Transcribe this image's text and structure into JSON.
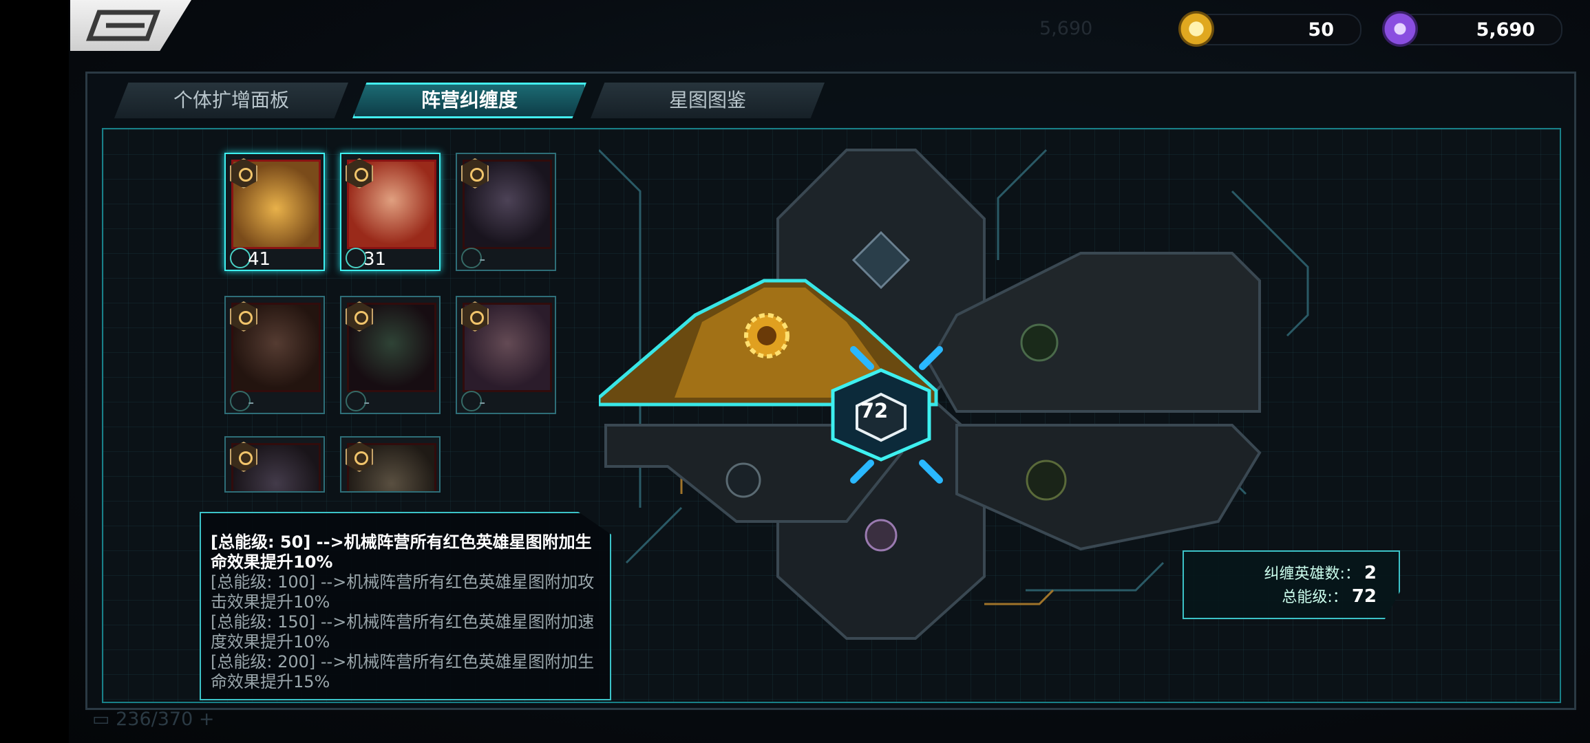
{
  "currencies": [
    {
      "value": "50",
      "icon": "gold-coin-icon"
    },
    {
      "value": "5,690",
      "icon": "purple-gem-icon"
    }
  ],
  "tabs": [
    {
      "label": "个体扩增面板"
    },
    {
      "label": "阵营纠缠度"
    },
    {
      "label": "星图图鉴"
    }
  ],
  "heroes": [
    {
      "level": "41",
      "selected": true
    },
    {
      "level": "31",
      "selected": true
    },
    {
      "level": "-",
      "selected": false
    },
    {
      "level": "-",
      "selected": false
    },
    {
      "level": "-",
      "selected": false
    },
    {
      "level": "-",
      "selected": false
    },
    {
      "level": "",
      "selected": false
    },
    {
      "level": "",
      "selected": false
    }
  ],
  "core": {
    "level": "72"
  },
  "bonus_lines": [
    "[总能级: 50] -->机械阵营所有红色英雄星图附加生命效果提升10%",
    "[总能级: 100] -->机械阵营所有红色英雄星图附加攻击效果提升10%",
    "[总能级: 150] -->机械阵营所有红色英雄星图附加速度效果提升10%",
    "[总能级: 200] -->机械阵营所有红色英雄星图附加生命效果提升15%"
  ],
  "summary": {
    "heroes_label": "纠缠英雄数:：",
    "heroes_value": "2",
    "total_label": "总能级:：",
    "total_value": "72"
  },
  "colors": {
    "accent": "#3ef0f0",
    "gold": "#f2b233",
    "panel": "#0b1217"
  }
}
